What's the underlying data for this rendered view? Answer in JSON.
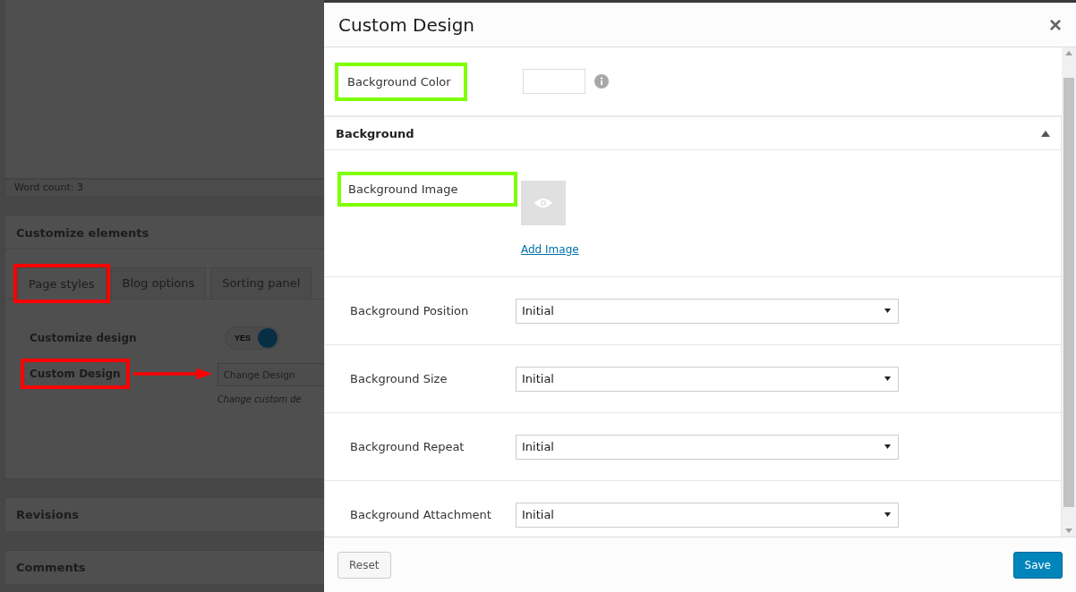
{
  "page": {
    "word_count": "Word count: 3",
    "customize": {
      "title": "Customize elements",
      "tabs": [
        {
          "label": "Page styles",
          "selected": true,
          "highlighted": true
        },
        {
          "label": "Blog options",
          "selected": false,
          "highlighted": false
        },
        {
          "label": "Sorting panel",
          "selected": false,
          "highlighted": false
        }
      ],
      "rows": [
        {
          "kind": "toggle",
          "label": "Customize design",
          "highlighted": false,
          "on": true,
          "toggle_text": "YES"
        },
        {
          "kind": "button",
          "label": "Custom Design",
          "highlighted": true,
          "button": "Change Design",
          "hint": "Change custom de"
        }
      ]
    },
    "panels": [
      {
        "title": "Revisions"
      },
      {
        "title": "Comments"
      }
    ]
  },
  "modal": {
    "title": "Custom Design",
    "close": "×",
    "fields": [
      {
        "kind": "color",
        "label": "Background Color",
        "highlighted": true
      }
    ],
    "section": {
      "title": "Background",
      "expanded": true,
      "fields": [
        {
          "kind": "image",
          "label": "Background Image",
          "highlighted": true,
          "link": "Add Image"
        },
        {
          "kind": "select",
          "label": "Background Position",
          "highlighted": false,
          "value": "Initial"
        },
        {
          "kind": "select",
          "label": "Background Size",
          "highlighted": false,
          "value": "Initial"
        },
        {
          "kind": "select",
          "label": "Background Repeat",
          "highlighted": false,
          "value": "Initial"
        },
        {
          "kind": "select",
          "label": "Background Attachment",
          "highlighted": false,
          "value": "Initial"
        }
      ]
    },
    "buttons": {
      "reset": "Reset",
      "save": "Save"
    }
  }
}
